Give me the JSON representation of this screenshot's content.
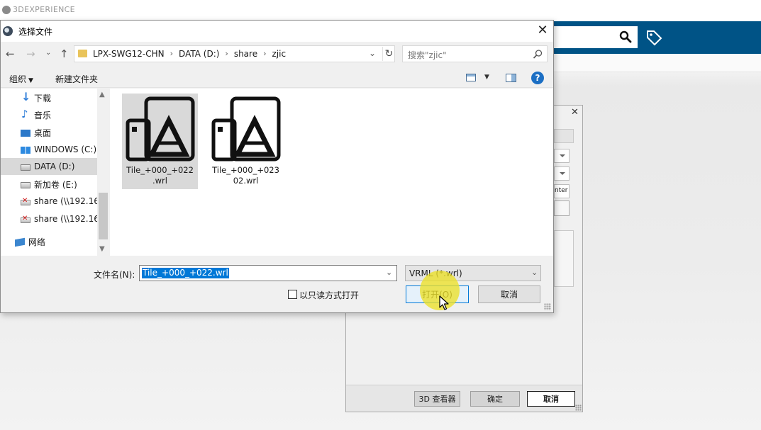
{
  "app": {
    "title": "3DEXPERIENCE",
    "accent_color": "#005386",
    "search_icon": "search-icon",
    "tag_icon": "tag-icon"
  },
  "background_dialog": {
    "text_field_fragment": "nter",
    "buttons": {
      "viewer": "3D 查看器",
      "ok": "确定",
      "cancel": "取消"
    }
  },
  "file_dialog": {
    "title": "选择文件",
    "breadcrumbs": [
      "LPX-SWG12-CHN",
      "DATA (D:)",
      "share",
      "zjic"
    ],
    "search_placeholder": "搜索\"zjic\"",
    "toolbar": {
      "organize": "组织",
      "new_folder": "新建文件夹"
    },
    "nav_items": [
      {
        "label": "下载",
        "icon": "download-icon",
        "selected": false
      },
      {
        "label": "音乐",
        "icon": "music-icon",
        "selected": false
      },
      {
        "label": "桌面",
        "icon": "desktop-icon",
        "selected": false
      },
      {
        "label": "WINDOWS (C:)",
        "icon": "windows-drive-icon",
        "selected": false
      },
      {
        "label": "DATA (D:)",
        "icon": "drive-icon",
        "selected": true
      },
      {
        "label": "新加卷 (E:)",
        "icon": "drive-icon",
        "selected": false
      },
      {
        "label": "share (\\\\192.16",
        "icon": "disconnected-drive-icon",
        "selected": false
      },
      {
        "label": "share (\\\\192.16",
        "icon": "disconnected-drive-icon",
        "selected": false
      },
      {
        "label": "网络",
        "icon": "network-icon",
        "selected": false
      }
    ],
    "files": [
      {
        "name": "Tile_+000_+022\n.wrl",
        "icon": "wrl-file-icon",
        "selected": true
      },
      {
        "name": "Tile_+000_+023\n02.wrl",
        "icon": "wrl-file-icon",
        "selected": false
      }
    ],
    "filename_label": "文件名(N):",
    "filename_value": "Tile_+000_+022.wrl",
    "filter_value": "VRML (*.wrl)",
    "readonly_label": "以只读方式打开",
    "readonly_checked": false,
    "open_label": "打开(O)",
    "cancel_label": "取消",
    "selection_color": "#0078d7",
    "cursor_highlight_color": "#ece028"
  }
}
